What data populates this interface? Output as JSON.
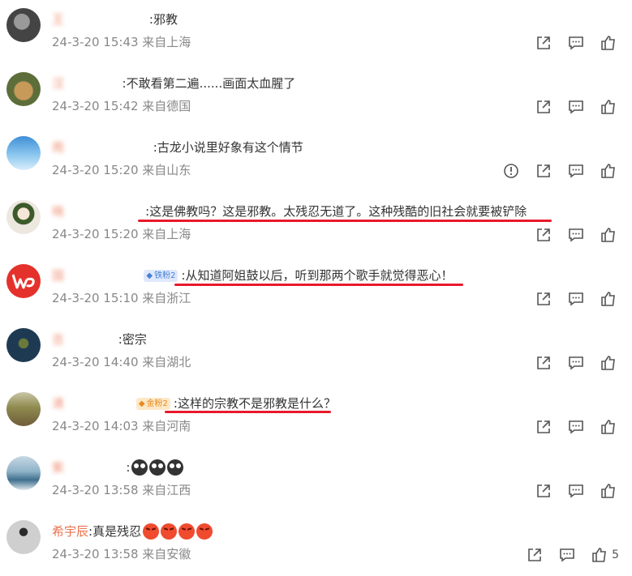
{
  "comments": [
    {
      "username": "王",
      "username_visible": false,
      "badge": null,
      "text": ":邪教",
      "time": "24-3-20 15:43 来自上海",
      "avatar_color": "#5a5a5a",
      "has_report": false,
      "like_count": ""
    },
    {
      "username": "汉",
      "username_visible": false,
      "badge": null,
      "text": ":不敢看第二遍......画面太血腥了",
      "time": "24-3-20 15:42 来自德国",
      "avatar_color": "#8a6a3a",
      "has_report": false,
      "like_count": ""
    },
    {
      "username": "雨",
      "username_visible": false,
      "badge": null,
      "text": ":古龙小说里好象有这个情节",
      "time": "24-3-20 15:20 来自山东",
      "avatar_color": "#6fb4e6",
      "has_report": true,
      "like_count": ""
    },
    {
      "username": "晓",
      "username_visible": false,
      "badge": null,
      "text": ":这是佛教吗？这是邪教。太残忍无道了。这种残酷的旧社会就要被铲除",
      "time": "24-3-20 15:20 来自上海",
      "avatar_color": "#e8e2d8",
      "has_report": false,
      "like_count": ""
    },
    {
      "username": "国",
      "username_visible": false,
      "badge": {
        "label": "铁粉2",
        "kind": "iron"
      },
      "text": ":从知道阿姐鼓以后，听到那两个歌手就觉得恶心！",
      "time": "24-3-20 15:10 来自浙江",
      "avatar_color": "#e5312b",
      "has_report": false,
      "like_count": ""
    },
    {
      "username": "吉",
      "username_visible": false,
      "badge": null,
      "text": ":密宗",
      "time": "24-3-20 14:40 来自湖北",
      "avatar_color": "#2c5a3a",
      "has_report": false,
      "like_count": ""
    },
    {
      "username": "清",
      "username_visible": false,
      "badge": {
        "label": "金粉2",
        "kind": "gold"
      },
      "text": ":这样的宗教不是邪教是什么？",
      "time": "24-3-20 14:03 来自河南",
      "avatar_color": "#7d8a4c",
      "has_report": false,
      "like_count": ""
    },
    {
      "username": "紫",
      "username_visible": false,
      "badge": null,
      "text": ":",
      "time": "24-3-20 13:58 来自江西",
      "avatar_color": "#4f7a9a",
      "has_report": false,
      "like_count": ""
    },
    {
      "username": "希宇辰",
      "username_visible": true,
      "badge": null,
      "text": ":真是残忍",
      "time": "24-3-20 13:58 来自安徽",
      "avatar_color": "#b5b5b5",
      "has_report": false,
      "like_count": "5"
    }
  ],
  "emoji_names": {
    "row8": [
      "crying-emoji",
      "crying-emoji",
      "crying-emoji"
    ],
    "row9": [
      "angry-emoji",
      "angry-emoji",
      "angry-emoji",
      "angry-emoji"
    ]
  },
  "icons": {
    "share": "share-icon",
    "comment": "comment-icon",
    "like": "thumbs-up-icon",
    "report": "report-icon"
  },
  "colors": {
    "username": "#eb7350",
    "meta": "#888888",
    "underline": "#e8192c"
  }
}
